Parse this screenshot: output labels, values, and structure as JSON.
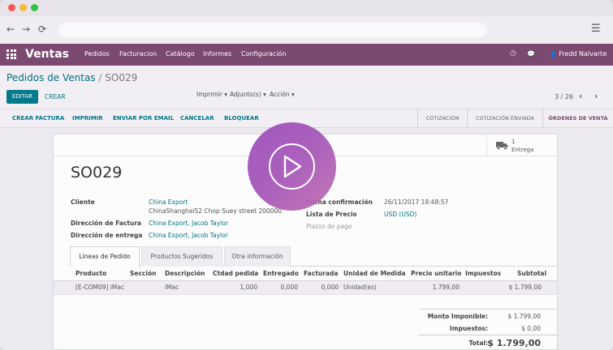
{
  "browser": {
    "back_glyph": "←",
    "forward_glyph": "→",
    "reload_glyph": "⟳",
    "menu_glyph": "☰"
  },
  "topnav": {
    "brand": "Ventas",
    "menu": [
      "Pedidos",
      "Facturacion",
      "Catálogo",
      "Informes",
      "Configuración"
    ],
    "clock_glyph": "◷",
    "chat_glyph": "💬",
    "user_glyph": "👤",
    "user_name": "Fredd Nalvarte",
    "bar_color": "#7c4971"
  },
  "breadcrumb": {
    "parent": "Pedidos de Ventas",
    "separator": "/",
    "current": "SO029"
  },
  "toolbar": {
    "edit_label": "EDITAR",
    "create_label": "CREAR",
    "print_label": "Imprimir ▾",
    "attach_label": "Adjunto(s) ▾",
    "action_label": "Acción ▾",
    "pager": "3 / 26",
    "prev_glyph": "‹",
    "next_glyph": "›"
  },
  "statusbar": {
    "actions": [
      "CREAR FACTURA",
      "IMPRIMIR",
      "ENVIAR POR EMAIL",
      "CANCELAR",
      "BLOQUEAR"
    ],
    "stages": [
      "COTIZACIÓN",
      "COTIZACIÓN ENVIADA",
      "ÓRDENES DE VENTA"
    ],
    "active_stage": "ÓRDENES DE VENTA"
  },
  "smart_button": {
    "count": "1",
    "label": "Entrega",
    "icon": "truck-icon"
  },
  "order": {
    "name": "SO029",
    "fields": {
      "customer_label": "Cliente",
      "customer_name": "China Export",
      "customer_address": "ChinaShanghai52 Chop Suey street 200000",
      "invoice_address_label": "Dirección de Factura",
      "invoice_address": "China Export, Jacob Taylor",
      "delivery_address_label": "Dirección de entrega",
      "delivery_address": "China Export, Jacob Taylor",
      "confirmation_date_label": "Fecha confirmación",
      "confirmation_date": "26/11/2017 18:48:57",
      "pricelist_label": "Lista de Precio",
      "pricelist": "USD (USD)",
      "payment_terms_label": "Plazos de pago"
    }
  },
  "tabs": [
    "Líneas de Pedido",
    "Productos Sugeridos",
    "Otra información"
  ],
  "order_lines": {
    "columns": [
      "Producto",
      "Sección",
      "Descripción",
      "Ctdad pedida",
      "Entregado",
      "Facturada",
      "Unidad de Medida",
      "Precio unitario",
      "Impuestos",
      "Subtotal"
    ],
    "rows": [
      {
        "product": "[E-COM09] iMac",
        "section": "",
        "description": "iMac",
        "qty": "1,000",
        "delivered": "0,000",
        "invoiced": "0,000",
        "uom": "Unidad(es)",
        "unit_price": "1.799,00",
        "taxes": "",
        "subtotal": "$ 1.799,00"
      }
    ]
  },
  "totals": {
    "untaxed_label": "Monto Imponible:",
    "untaxed": "$ 1.799,00",
    "taxes_label": "Impuestos:",
    "taxes": "$ 0,00",
    "total_label": "Total:",
    "total": "$ 1.799,00"
  },
  "overlay": {
    "icon": "play-icon"
  }
}
